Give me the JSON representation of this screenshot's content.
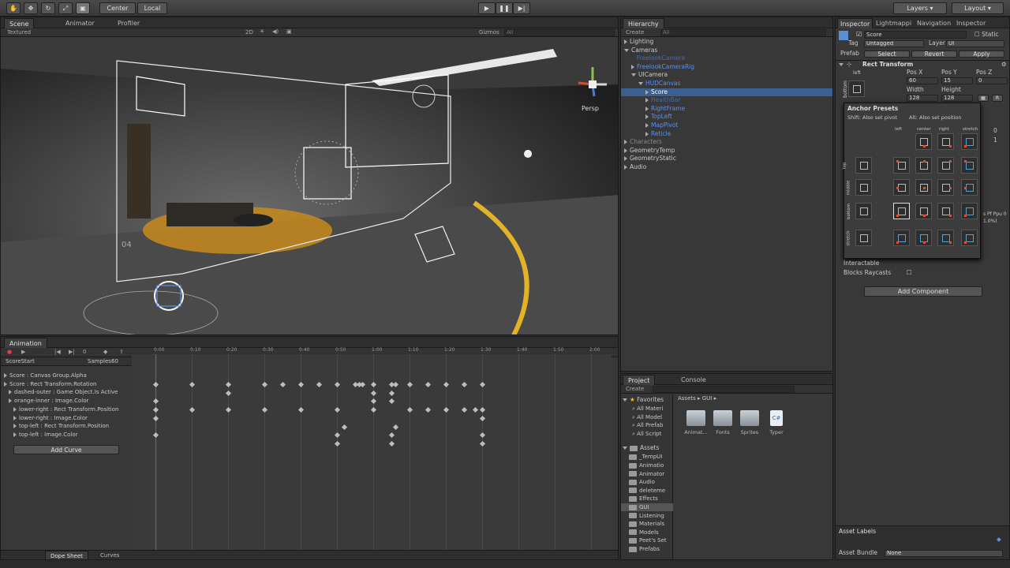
{
  "toolbar": {
    "tools": [
      "hand-icon",
      "move-icon",
      "rotate-icon",
      "scale-icon",
      "rect-tool-icon"
    ],
    "pivot_label": "Center",
    "space_label": "Local",
    "play": "▶",
    "pause": "❚❚",
    "step": "▶|",
    "layers_label": "Layers",
    "layout_label": "Layout"
  },
  "scene": {
    "tabs": [
      "Scene",
      "Animator",
      "Profiler"
    ],
    "shading": "Textured",
    "mode_2d": "2D",
    "gizmos": "Gizmos",
    "search_placeholder": "All",
    "persp_label": "Persp",
    "number_label": "04"
  },
  "hierarchy": {
    "tab": "Hierarchy",
    "create": "Create",
    "search_placeholder": "All",
    "items": [
      {
        "label": "Lighting",
        "depth": 0,
        "arrow": "right",
        "color": "normal"
      },
      {
        "label": "Cameras",
        "depth": 0,
        "arrow": "down",
        "color": "normal"
      },
      {
        "label": "FreelookCamera",
        "depth": 1,
        "arrow": "none",
        "color": "dimblue"
      },
      {
        "label": "FreelookCameraRig",
        "depth": 1,
        "arrow": "right",
        "color": "blue"
      },
      {
        "label": "UICamera",
        "depth": 1,
        "arrow": "down",
        "color": "normal"
      },
      {
        "label": "HUDCanvas",
        "depth": 2,
        "arrow": "down",
        "color": "blue"
      },
      {
        "label": "Score",
        "depth": 3,
        "arrow": "right",
        "color": "normal",
        "selected": true
      },
      {
        "label": "HealthBar",
        "depth": 3,
        "arrow": "right",
        "color": "dimblue"
      },
      {
        "label": "RightFrame",
        "depth": 3,
        "arrow": "right",
        "color": "blue"
      },
      {
        "label": "TopLeft",
        "depth": 3,
        "arrow": "right",
        "color": "blue"
      },
      {
        "label": "MapPivot",
        "depth": 3,
        "arrow": "right",
        "color": "blue"
      },
      {
        "label": "Reticle",
        "depth": 3,
        "arrow": "right",
        "color": "blue"
      },
      {
        "label": "Characters",
        "depth": 0,
        "arrow": "right",
        "color": "dim"
      },
      {
        "label": "GeometryTemp",
        "depth": 0,
        "arrow": "right",
        "color": "normal"
      },
      {
        "label": "GeometryStatic",
        "depth": 0,
        "arrow": "right",
        "color": "normal"
      },
      {
        "label": "Audio",
        "depth": 0,
        "arrow": "right",
        "color": "normal"
      }
    ]
  },
  "inspector": {
    "tabs": [
      "Inspector",
      "Lightmappi",
      "Navigation",
      "Inspector"
    ],
    "object_name": "Score",
    "static_label": "Static",
    "tag_label": "Tag",
    "tag_value": "Untagged",
    "layer_label": "Layer",
    "layer_value": "UI",
    "prefab_label": "Prefab",
    "select": "Select",
    "revert": "Revert",
    "apply": "Apply",
    "component": "Rect Transform",
    "anchor_h": "left",
    "anchor_v": "bottom",
    "pos_x_label": "Pos X",
    "pos_y_label": "Pos Y",
    "pos_z_label": "Pos Z",
    "pos_x": "60",
    "pos_y": "15",
    "pos_z": "0",
    "width_label": "Width",
    "height_label": "Height",
    "width": "128",
    "height": "128",
    "r_btn": "R",
    "anchor_presets": {
      "title": "Anchor Presets",
      "hint_shift": "Shift: Also set pivot",
      "hint_alt": "Alt: Also set position",
      "col_labels": [
        "left",
        "center",
        "right",
        "stretch"
      ],
      "row_labels": [
        "top",
        "middle",
        "bottom",
        "stretch"
      ]
    },
    "right_values": [
      "0",
      "1"
    ],
    "ppu_text": "s Pf Ppu 0",
    "ppu_text2": "1.0%)",
    "interactable": "Interactable",
    "blocks_raycasts": "Blocks Raycasts",
    "add_component": "Add Component",
    "asset_labels": "Asset Labels",
    "asset_bundle": "Asset Bundle",
    "asset_bundle_value": "None"
  },
  "animation": {
    "tab": "Animation",
    "frame": "0",
    "clip": "ScoreStart",
    "samples_label": "Samples",
    "samples": "60",
    "timeline": [
      "0:00",
      "0:10",
      "0:20",
      "0:30",
      "0:40",
      "0:50",
      "1:00",
      "1:10",
      "1:20",
      "1:30",
      "1:40",
      "1:50",
      "2:00"
    ],
    "tracks": [
      {
        "label": "Score : Canvas Group.Alpha",
        "indent": 0,
        "keys": [
          0,
          10,
          20,
          30,
          35,
          40,
          45,
          50,
          55,
          56,
          57,
          60,
          65,
          66,
          70,
          75,
          80,
          85,
          90
        ]
      },
      {
        "label": "Score : Rect Transform.Rotation",
        "indent": 0,
        "keys": [
          20,
          60,
          65
        ]
      },
      {
        "label": "dashed-outer : Game Object.Is Active",
        "indent": 1,
        "keys": [
          0,
          60,
          65
        ]
      },
      {
        "label": "orange-inner : Image.Color",
        "indent": 1,
        "keys": [
          0,
          10,
          20,
          30,
          40,
          50,
          60,
          70,
          75,
          80,
          85,
          88,
          90
        ]
      },
      {
        "label": "lower-right : Rect Transform.Position",
        "indent": 2,
        "keys": [
          0,
          90
        ]
      },
      {
        "label": "lower-right : Image.Color",
        "indent": 2,
        "keys": [
          52,
          66
        ]
      },
      {
        "label": "top-left : Rect Transform.Position",
        "indent": 2,
        "keys": [
          0,
          50,
          65,
          90
        ]
      },
      {
        "label": "top-left : Image.Color",
        "indent": 2,
        "keys": [
          50,
          65,
          90
        ]
      }
    ],
    "add_curve": "Add Curve",
    "dope_sheet": "Dope Sheet",
    "curves": "Curves"
  },
  "project": {
    "tabs": [
      "Project",
      "Console"
    ],
    "create": "Create",
    "favorites": "Favorites",
    "favorite_items": [
      "All Materi",
      "All Model",
      "All Prefab",
      "All Script"
    ],
    "assets_root": "Assets",
    "asset_folders": [
      "_TempUI",
      "Animatio",
      "Animator",
      "Audio",
      "deleteme",
      "Effects",
      "GUI",
      "Listening",
      "Materials",
      "Models",
      "Peet's Set",
      "Prefabs"
    ],
    "breadcrumb": [
      "Assets",
      "GUI"
    ],
    "grid_items": [
      {
        "label": "Animat...",
        "kind": "folder"
      },
      {
        "label": "Fonts",
        "kind": "folder"
      },
      {
        "label": "Sprites",
        "kind": "folder"
      },
      {
        "label": "Typer",
        "kind": "script"
      }
    ],
    "script_badge": "C#"
  },
  "colors": {
    "accent_blue": "#5b8ff0",
    "selection": "#3d5f8f",
    "keyframe": "#bdbdbd",
    "preset_dot": "#e05030",
    "preset_blue": "#4fa3d8"
  }
}
